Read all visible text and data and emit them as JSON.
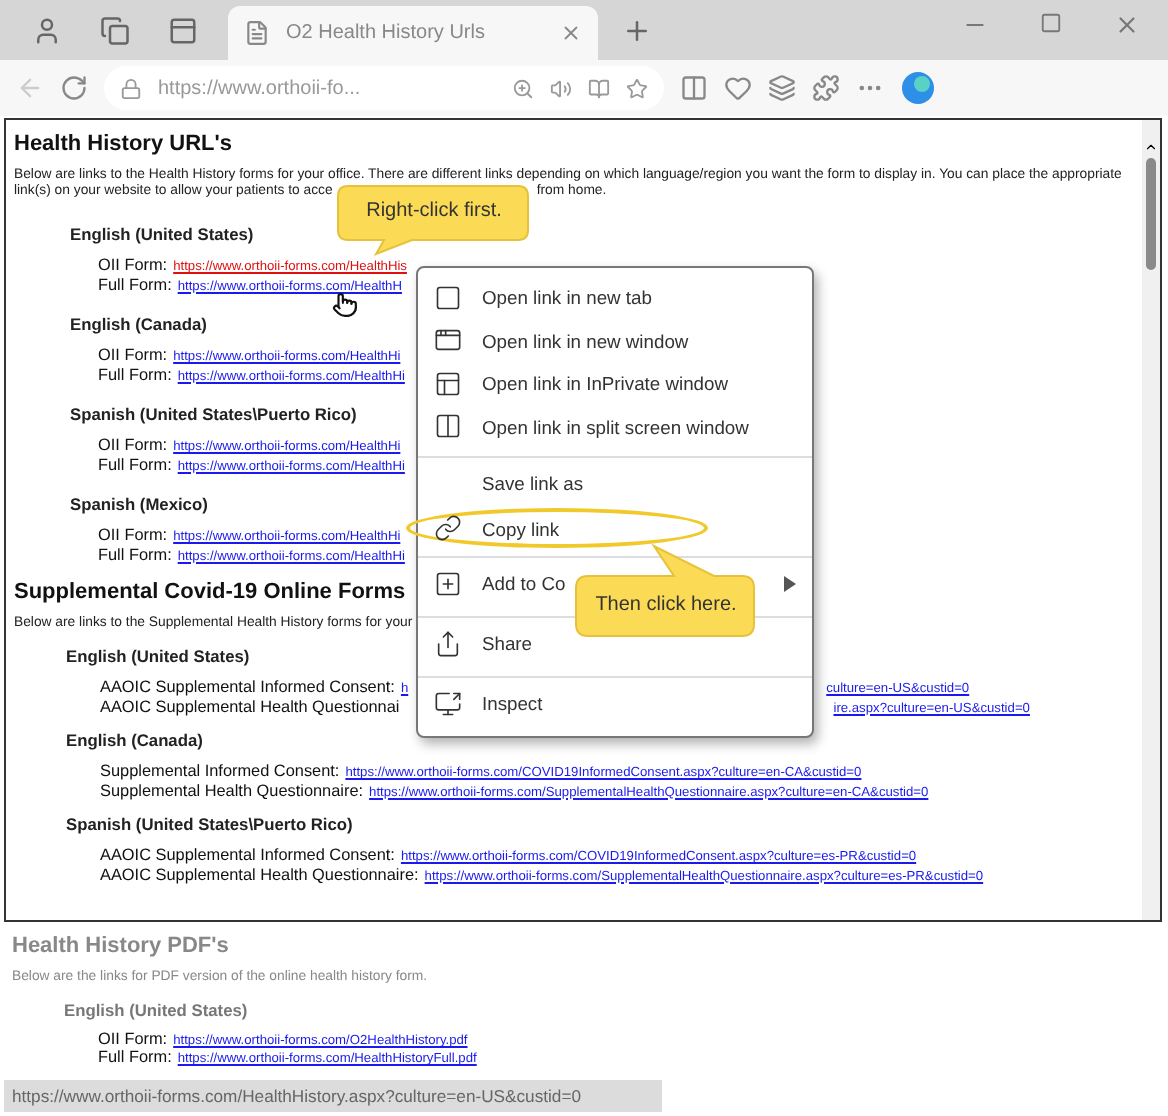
{
  "browser": {
    "tab_title": "O2 Health History Urls",
    "address": "https://www.orthoii-fo..."
  },
  "page": {
    "heading": "Health History URL's",
    "intro_line1": "Below are links to the Health History forms for your office. There are different links depending on which language/region you want the form to display in. You can place the appropriate",
    "intro_line2_start": "link(s) on your website to allow your patients to acce",
    "intro_line2_end": "from home.",
    "groups": [
      {
        "title": "English (United States)",
        "rows": [
          {
            "label": "OII Form:",
            "link": "https://www.orthoii-forms.com/HealthHis",
            "active": true
          },
          {
            "label": "Full Form:",
            "link": "https://www.orthoii-forms.com/HealthH",
            "active": false
          }
        ]
      },
      {
        "title": "English (Canada)",
        "rows": [
          {
            "label": "OII Form:",
            "link": "https://www.orthoii-forms.com/HealthHi",
            "active": false
          },
          {
            "label": "Full Form:",
            "link": "https://www.orthoii-forms.com/HealthHi",
            "active": false
          }
        ]
      },
      {
        "title": "Spanish (United States\\Puerto Rico)",
        "rows": [
          {
            "label": "OII Form:",
            "link": "https://www.orthoii-forms.com/HealthHi",
            "active": false
          },
          {
            "label": "Full Form:",
            "link": "https://www.orthoii-forms.com/HealthHi",
            "active": false
          }
        ]
      },
      {
        "title": "Spanish (Mexico)",
        "rows": [
          {
            "label": "OII Form:",
            "link": "https://www.orthoii-forms.com/HealthHi",
            "active": false
          },
          {
            "label": "Full Form:",
            "link": "https://www.orthoii-forms.com/HealthHi",
            "active": false
          }
        ]
      }
    ]
  },
  "supplemental": {
    "heading": "Supplemental Covid-19 Online Forms",
    "intro": "Below are links to the Supplemental Health History forms for your",
    "groups": [
      {
        "title": "English (United States)",
        "rows": [
          {
            "label": "AAOIC Supplemental Informed Consent:",
            "link": "h",
            "link_tail": "culture=en-US&custid=0"
          },
          {
            "label": "AAOIC Supplemental Health Questionnai",
            "link_tail": "ire.aspx?culture=en-US&custid=0"
          }
        ]
      },
      {
        "title": "English (Canada)",
        "rows": [
          {
            "label": "Supplemental Informed Consent:",
            "link": "https://www.orthoii-forms.com/COVID19InformedConsent.aspx?culture=en-CA&custid=0"
          },
          {
            "label": "Supplemental Health Questionnaire:",
            "link": "https://www.orthoii-forms.com/SupplementalHealthQuestionnaire.aspx?culture=en-CA&custid=0"
          }
        ]
      },
      {
        "title": "Spanish (United States\\Puerto Rico)",
        "rows": [
          {
            "label": "AAOIC Supplemental Informed Consent:",
            "link": "https://www.orthoii-forms.com/COVID19InformedConsent.aspx?culture=es-PR&custid=0"
          },
          {
            "label": "AAOIC Supplemental Health Questionnaire:",
            "link": "https://www.orthoii-forms.com/SupplementalHealthQuestionnaire.aspx?culture=es-PR&custid=0"
          }
        ]
      }
    ]
  },
  "pdf_section": {
    "heading": "Health History PDF's",
    "intro": "Below are the links for PDF version of the online health history form.",
    "title": "English (United States)",
    "rows": [
      {
        "label": "OII Form:",
        "link": "https://www.orthoii-forms.com/O2HealthHistory.pdf"
      },
      {
        "label": "Full Form:",
        "link": "https://www.orthoii-forms.com/HealthHistoryFull.pdf"
      }
    ]
  },
  "context_menu": [
    {
      "label": "Open link in new tab",
      "kind": "tab",
      "separator_before": false,
      "submenu": false,
      "highlighted": false
    },
    {
      "label": "Open link in new window",
      "kind": "window",
      "separator_before": false,
      "submenu": false,
      "highlighted": false
    },
    {
      "label": "Open link in InPrivate window",
      "kind": "private",
      "separator_before": false,
      "submenu": false,
      "highlighted": false
    },
    {
      "label": "Open link in split screen window",
      "kind": "split",
      "separator_before": false,
      "submenu": false,
      "highlighted": false
    },
    {
      "label": "Save link as",
      "kind": "plain",
      "separator_before": true,
      "submenu": false,
      "highlighted": false
    },
    {
      "label": "Copy link",
      "kind": "link",
      "separator_before": false,
      "submenu": false,
      "highlighted": true
    },
    {
      "label": "Add to Co",
      "kind": "collection",
      "separator_before": true,
      "submenu": true,
      "highlighted": false
    },
    {
      "label": "Share",
      "kind": "share",
      "separator_before": true,
      "submenu": false,
      "highlighted": false
    },
    {
      "label": "Inspect",
      "kind": "inspect",
      "separator_before": true,
      "submenu": false,
      "highlighted": false
    }
  ],
  "callouts": [
    "Right-click first.",
    "Then click here."
  ],
  "status_url": "https://www.orthoii-forms.com/HealthHistory.aspx?culture=en-US&custid=0"
}
